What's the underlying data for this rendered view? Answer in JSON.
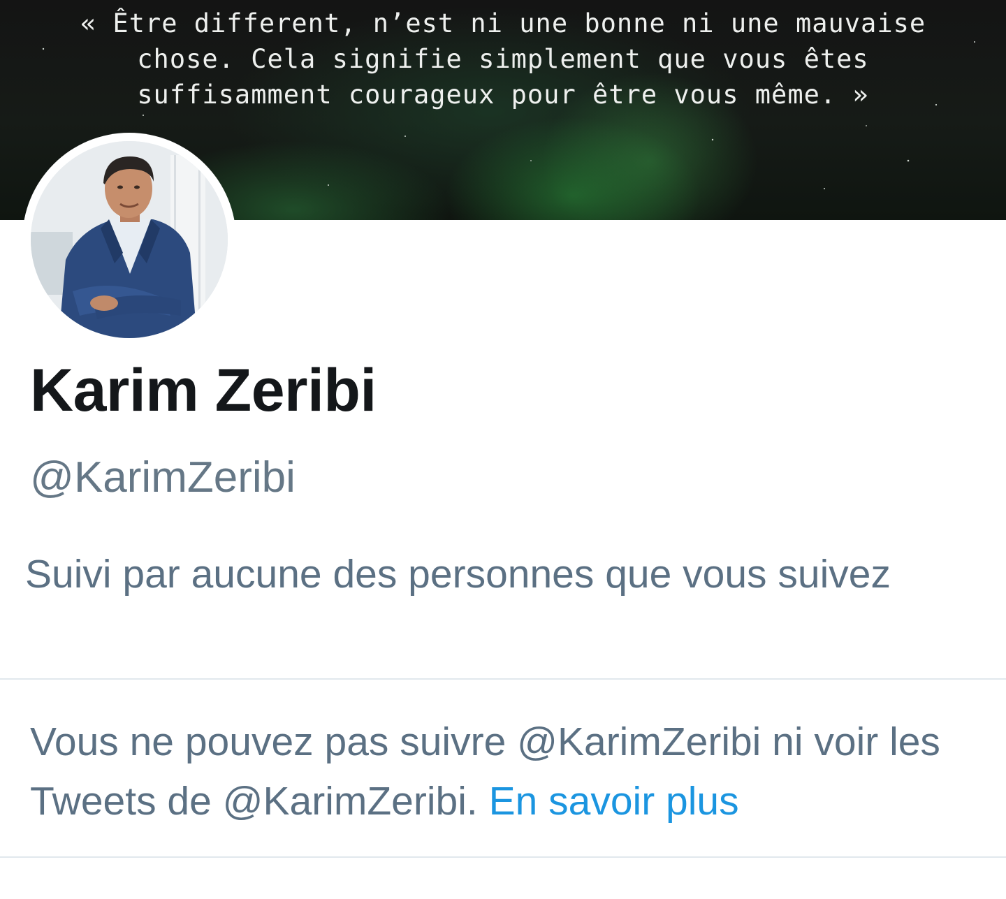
{
  "banner": {
    "quote": "« Être different, n’est ni une bonne ni une mauvaise\nchose. Cela signifie simplement que vous êtes\nsuffisamment courageux pour être vous même. »"
  },
  "profile": {
    "display_name": "Karim Zeribi",
    "handle": "@KarimZeribi",
    "followed_by": "Suivi par aucune des personnes que vous suivez"
  },
  "notice": {
    "text": "Vous ne pouvez pas suivre @KarimZeribi ni voir les Tweets de @KarimZeribi.",
    "link_label": "En savoir plus"
  },
  "colors": {
    "name": "#14171a",
    "secondary_text": "#657786",
    "link": "#1b95e0",
    "divider": "#e1e8ed"
  }
}
